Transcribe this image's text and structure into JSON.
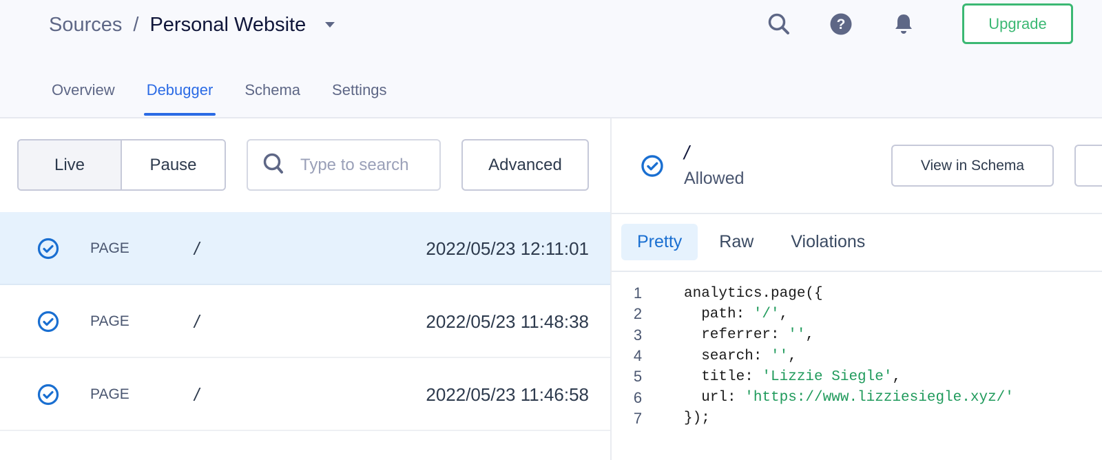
{
  "header": {
    "breadcrumb": {
      "parent": "Sources",
      "separator": "/",
      "current": "Personal Website"
    },
    "icons": [
      "search-icon",
      "help-icon",
      "bell-icon"
    ],
    "upgrade_label": "Upgrade",
    "tabs": [
      {
        "label": "Overview",
        "active": false
      },
      {
        "label": "Debugger",
        "active": true
      },
      {
        "label": "Schema",
        "active": false
      },
      {
        "label": "Settings",
        "active": false
      }
    ]
  },
  "controls": {
    "live_label": "Live",
    "pause_label": "Pause",
    "search_placeholder": "Type to search",
    "search_value": "",
    "advanced_label": "Advanced"
  },
  "events": [
    {
      "type": "PAGE",
      "path": "/",
      "timestamp": "2022/05/23 12:11:01",
      "status": "allowed",
      "selected": true
    },
    {
      "type": "PAGE",
      "path": "/",
      "timestamp": "2022/05/23 11:48:38",
      "status": "allowed",
      "selected": false
    },
    {
      "type": "PAGE",
      "path": "/",
      "timestamp": "2022/05/23 11:46:58",
      "status": "allowed",
      "selected": false
    }
  ],
  "detail": {
    "path": "/",
    "status": "Allowed",
    "view_schema_label": "View in Schema",
    "tabs": [
      {
        "label": "Pretty",
        "active": true
      },
      {
        "label": "Raw",
        "active": false
      },
      {
        "label": "Violations",
        "active": false
      }
    ],
    "code": [
      {
        "n": "1",
        "pre": "analytics.page({",
        "str": "",
        "post": ""
      },
      {
        "n": "2",
        "pre": "  path: ",
        "str": "'/'",
        "post": ","
      },
      {
        "n": "3",
        "pre": "  referrer: ",
        "str": "''",
        "post": ","
      },
      {
        "n": "4",
        "pre": "  search: ",
        "str": "''",
        "post": ","
      },
      {
        "n": "5",
        "pre": "  title: ",
        "str": "'Lizzie Siegle'",
        "post": ","
      },
      {
        "n": "6",
        "pre": "  url: ",
        "str": "'https://www.lizziesiegle.xyz/'",
        "post": ""
      },
      {
        "n": "7",
        "pre": "});",
        "str": "",
        "post": ""
      }
    ]
  },
  "colors": {
    "accent": "#2b6be5",
    "upgrade": "#3bb873",
    "selected_row": "#e6f2fd",
    "check": "#1a6fd1",
    "code_string": "#1f9a5b"
  }
}
